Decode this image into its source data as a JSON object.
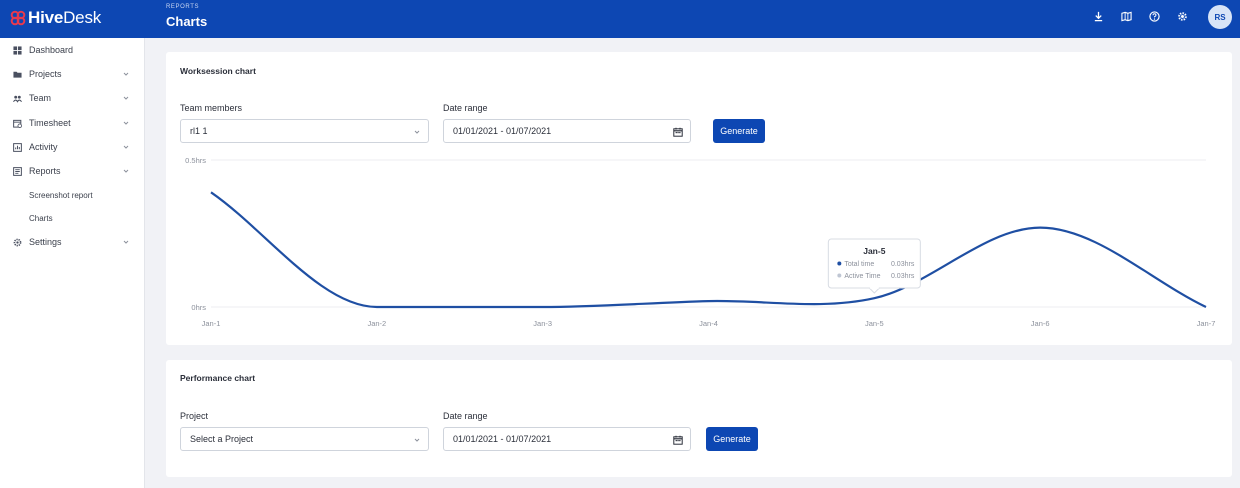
{
  "app": {
    "logo_word_1": "Hive",
    "logo_word_2": "Desk",
    "breadcrumb": "REPORTS",
    "page_title": "Charts",
    "user_initials": "RS"
  },
  "icons": {
    "download": "download-icon",
    "map": "map-icon",
    "help": "help-icon",
    "settings": "gear-icon"
  },
  "sidebar": {
    "items": [
      {
        "label": "Dashboard",
        "icon": "dashboard-icon",
        "expandable": false
      },
      {
        "label": "Projects",
        "icon": "folder-icon",
        "expandable": true
      },
      {
        "label": "Team",
        "icon": "team-icon",
        "expandable": true
      },
      {
        "label": "Timesheet",
        "icon": "timesheet-icon",
        "expandable": true
      },
      {
        "label": "Activity",
        "icon": "activity-icon",
        "expandable": true
      },
      {
        "label": "Reports",
        "icon": "reports-icon",
        "expandable": true
      },
      {
        "label": "Settings",
        "icon": "settings-icon",
        "expandable": true
      }
    ],
    "reports_sub": [
      "Screenshot report",
      "Charts"
    ]
  },
  "worksession": {
    "title": "Worksession chart",
    "team_label": "Team members",
    "team_value": "rl1 1",
    "date_label": "Date range",
    "date_value": "01/01/2021 - 01/07/2021",
    "generate": "Generate"
  },
  "performance": {
    "title": "Performance chart",
    "project_label": "Project",
    "project_value": "Select a Project",
    "date_label": "Date range",
    "date_value": "01/01/2021 - 01/07/2021",
    "generate": "Generate"
  },
  "chart_data": {
    "type": "line",
    "categories": [
      "Jan-1",
      "Jan-2",
      "Jan-3",
      "Jan-4",
      "Jan-5",
      "Jan-6",
      "Jan-7"
    ],
    "series": [
      {
        "name": "Total time",
        "values": [
          0.39,
          0.0,
          0.0,
          0.02,
          0.03,
          0.27,
          0.0
        ],
        "color": "#1f4fa3"
      }
    ],
    "y_tick_labels": [
      "0hrs",
      "0.5hrs"
    ],
    "ylim": [
      0,
      0.5
    ],
    "grid": true,
    "tooltip": {
      "title": "Jan-5",
      "rows": [
        {
          "label": "Total time",
          "value": "0.03hrs",
          "color": "#1f4fa3"
        },
        {
          "label": "Active Time",
          "value": "0.03hrs",
          "color": "#bfc6d3"
        }
      ]
    }
  }
}
